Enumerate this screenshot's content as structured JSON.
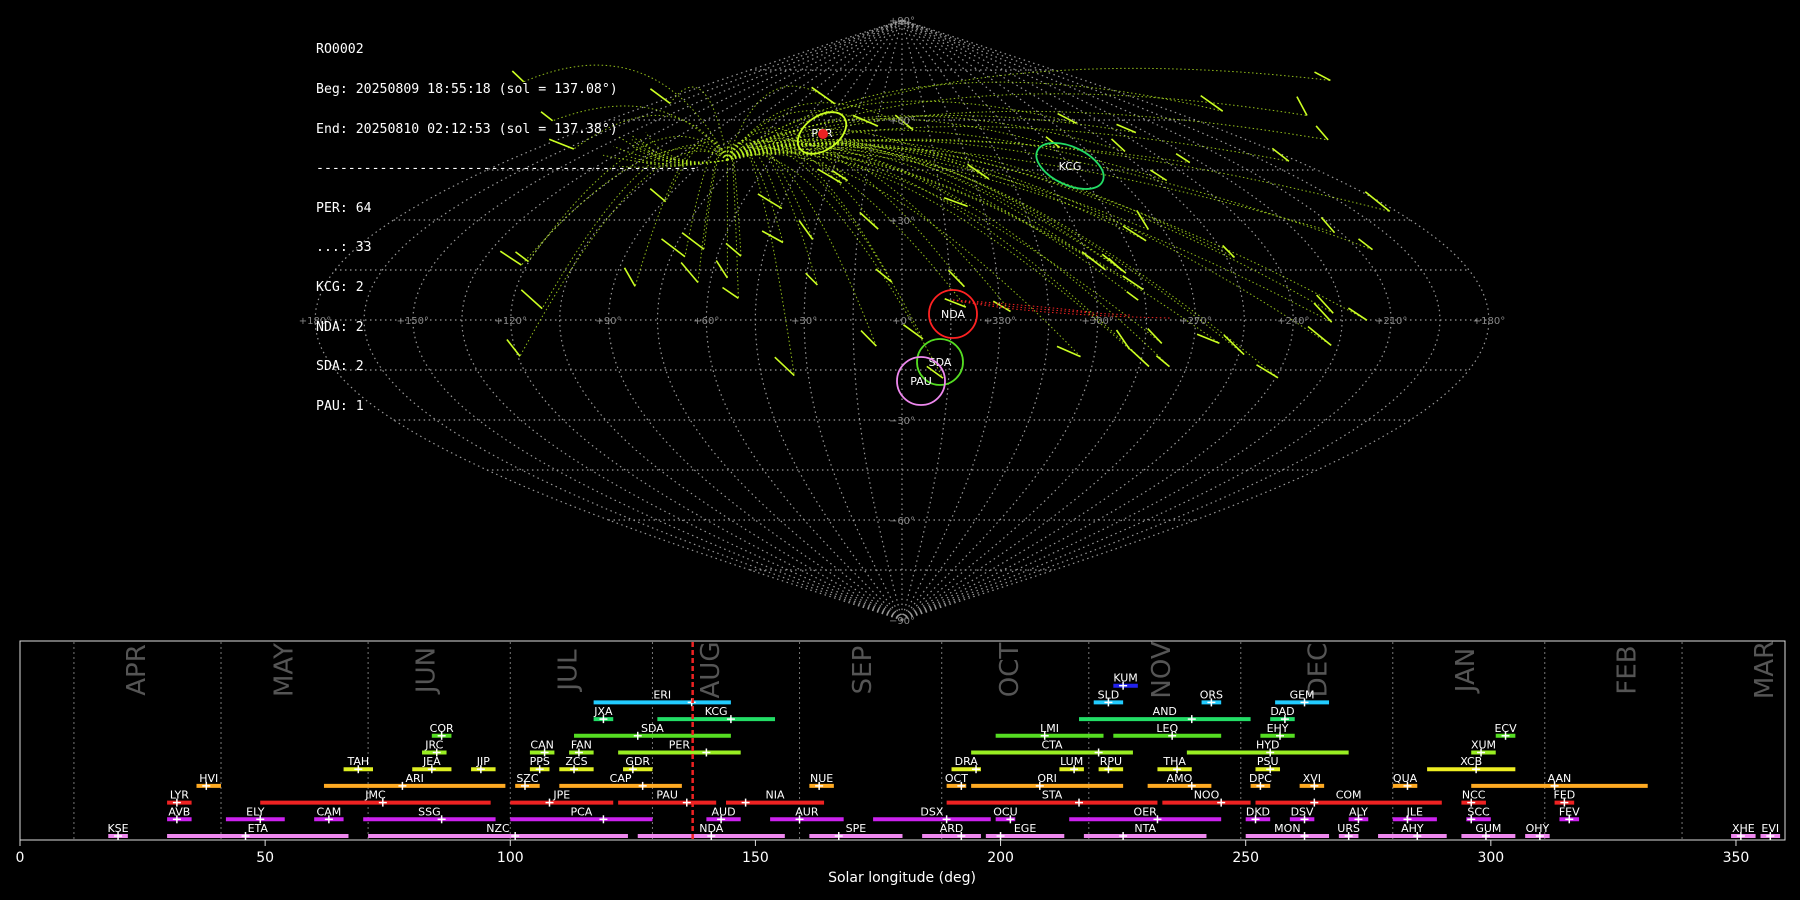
{
  "info": {
    "id": "RO0002",
    "beg": "Beg: 20250809 18:55:18 (sol = 137.08°)",
    "end": "End: 20250810 02:12:53 (sol = 137.38°)",
    "separator": "------------------------------------------------",
    "counts": [
      "PER: 64",
      "...: 33",
      "KCG: 2",
      "NDA: 2",
      "SDA: 2",
      "PAU: 1"
    ]
  },
  "sky_map": {
    "lon_labels": [
      "+180°",
      "+150°",
      "+120°",
      "+90°",
      "+60°",
      "+30°",
      "+0°",
      "+330°",
      "+300°",
      "+270°",
      "+240°",
      "+210°",
      "+180°"
    ],
    "lat_labels": [
      "+90°",
      "+60°",
      "+30°",
      "−30°",
      "−60°",
      "−90°"
    ],
    "radiants": [
      {
        "name": "PER",
        "color": "#ccff22"
      },
      {
        "name": "KCG",
        "color": "#22dd66"
      },
      {
        "name": "NDA",
        "color": "#ff2222"
      },
      {
        "name": "SDA",
        "color": "#55dd22"
      },
      {
        "name": "PAU",
        "color": "#ee88ee"
      }
    ]
  },
  "chart_data": {
    "type": "bar",
    "xlabel": "Solar longitude (deg)",
    "xlim": [
      0,
      360
    ],
    "xticks": [
      0,
      50,
      100,
      150,
      200,
      250,
      300,
      350
    ],
    "current_sol": 137.2,
    "months": [
      {
        "name": "APR",
        "start": 11,
        "mid": 24
      },
      {
        "name": "MAY",
        "start": 41,
        "mid": 54
      },
      {
        "name": "JUN",
        "start": 71,
        "mid": 83
      },
      {
        "name": "JUL",
        "start": 100,
        "mid": 112
      },
      {
        "name": "AUG",
        "start": 129,
        "mid": 141
      },
      {
        "name": "SEP",
        "start": 159,
        "mid": 172
      },
      {
        "name": "OCT",
        "start": 188,
        "mid": 202
      },
      {
        "name": "NOV",
        "start": 218,
        "mid": 233
      },
      {
        "name": "DEC",
        "start": 249,
        "mid": 265
      },
      {
        "name": "JAN",
        "start": 280,
        "mid": 295
      },
      {
        "name": "FEB",
        "start": 311,
        "mid": 328
      },
      {
        "name": "MAR",
        "start": 339,
        "mid": 356
      }
    ],
    "showers": [
      {
        "name": "KUM",
        "start": 223,
        "end": 228,
        "peak": 225,
        "row": 10,
        "color": "#2222ee"
      },
      {
        "name": "ERI",
        "start": 117,
        "end": 145,
        "peak": 137,
        "row": 9,
        "color": "#22ccff"
      },
      {
        "name": "SLD",
        "start": 219,
        "end": 225,
        "peak": 222,
        "row": 9,
        "color": "#22ccff"
      },
      {
        "name": "ORS",
        "start": 241,
        "end": 245,
        "peak": 243,
        "row": 9,
        "color": "#22ccff"
      },
      {
        "name": "GEM",
        "start": 256,
        "end": 267,
        "peak": 262,
        "row": 9,
        "color": "#22ccff"
      },
      {
        "name": "JXA",
        "start": 117,
        "end": 121,
        "peak": 119,
        "row": 8,
        "color": "#22dd66"
      },
      {
        "name": "KCG",
        "start": 130,
        "end": 154,
        "peak": 145,
        "row": 8,
        "color": "#22dd66"
      },
      {
        "name": "AND",
        "start": 216,
        "end": 251,
        "peak": 239,
        "row": 8,
        "color": "#22dd66"
      },
      {
        "name": "DAD",
        "start": 255,
        "end": 260,
        "peak": 258,
        "row": 8,
        "color": "#22dd66"
      },
      {
        "name": "COR",
        "start": 84,
        "end": 88,
        "peak": 86,
        "row": 7,
        "color": "#55dd22"
      },
      {
        "name": "SDA",
        "start": 113,
        "end": 145,
        "peak": 126,
        "row": 7,
        "color": "#55dd22"
      },
      {
        "name": "LMI",
        "start": 199,
        "end": 221,
        "peak": 209,
        "row": 7,
        "color": "#55dd22"
      },
      {
        "name": "LEQ",
        "start": 223,
        "end": 245,
        "peak": 235,
        "row": 7,
        "color": "#55dd22"
      },
      {
        "name": "EHY",
        "start": 253,
        "end": 260,
        "peak": 257,
        "row": 7,
        "color": "#55dd22"
      },
      {
        "name": "ECV",
        "start": 301,
        "end": 305,
        "peak": 303,
        "row": 7,
        "color": "#55dd22"
      },
      {
        "name": "JRC",
        "start": 82,
        "end": 87,
        "peak": 85,
        "row": 6,
        "color": "#99ee22"
      },
      {
        "name": "CAN",
        "start": 104,
        "end": 109,
        "peak": 107,
        "row": 6,
        "color": "#99ee22"
      },
      {
        "name": "FAN",
        "start": 112,
        "end": 117,
        "peak": 114,
        "row": 6,
        "color": "#99ee22"
      },
      {
        "name": "PER",
        "start": 122,
        "end": 147,
        "peak": 140,
        "row": 6,
        "color": "#99ee22"
      },
      {
        "name": "CTA",
        "start": 194,
        "end": 227,
        "peak": 220,
        "row": 6,
        "color": "#99ee22"
      },
      {
        "name": "HYD",
        "start": 238,
        "end": 271,
        "peak": 255,
        "row": 6,
        "color": "#99ee22"
      },
      {
        "name": "XUM",
        "start": 296,
        "end": 301,
        "peak": 298,
        "row": 6,
        "color": "#99ee22"
      },
      {
        "name": "TAH",
        "start": 66,
        "end": 72,
        "peak": 69,
        "row": 5,
        "color": "#ddee22"
      },
      {
        "name": "JEA",
        "start": 80,
        "end": 88,
        "peak": 84,
        "row": 5,
        "color": "#ddee22"
      },
      {
        "name": "JIP",
        "start": 92,
        "end": 97,
        "peak": 94,
        "row": 5,
        "color": "#ddee22"
      },
      {
        "name": "PPS",
        "start": 104,
        "end": 108,
        "peak": 106,
        "row": 5,
        "color": "#ddee22"
      },
      {
        "name": "ZCS",
        "start": 110,
        "end": 117,
        "peak": 113,
        "row": 5,
        "color": "#ddee22"
      },
      {
        "name": "GDR",
        "start": 123,
        "end": 129,
        "peak": 125,
        "row": 5,
        "color": "#ddee22"
      },
      {
        "name": "DRA",
        "start": 190,
        "end": 196,
        "peak": 195,
        "row": 5,
        "color": "#ddee22"
      },
      {
        "name": "LUM",
        "start": 212,
        "end": 217,
        "peak": 215,
        "row": 5,
        "color": "#ddee22"
      },
      {
        "name": "RPU",
        "start": 220,
        "end": 225,
        "peak": 222,
        "row": 5,
        "color": "#ddee22"
      },
      {
        "name": "THA",
        "start": 232,
        "end": 239,
        "peak": 236,
        "row": 5,
        "color": "#ddee22"
      },
      {
        "name": "PSU",
        "start": 252,
        "end": 257,
        "peak": 255,
        "row": 5,
        "color": "#ddee22"
      },
      {
        "name": "XCB",
        "start": 287,
        "end": 305,
        "peak": 297,
        "row": 5,
        "color": "#eeee22"
      },
      {
        "name": "HVI",
        "start": 36,
        "end": 41,
        "peak": 38,
        "row": 4,
        "color": "#ffaa22"
      },
      {
        "name": "ARI",
        "start": 62,
        "end": 99,
        "peak": 78,
        "row": 4,
        "color": "#ffaa22"
      },
      {
        "name": "SZC",
        "start": 101,
        "end": 106,
        "peak": 103,
        "row": 4,
        "color": "#ffaa22"
      },
      {
        "name": "CAP",
        "start": 110,
        "end": 135,
        "peak": 127,
        "row": 4,
        "color": "#ffaa22"
      },
      {
        "name": "NUE",
        "start": 161,
        "end": 166,
        "peak": 163,
        "row": 4,
        "color": "#ffaa22"
      },
      {
        "name": "OCT",
        "start": 189,
        "end": 193,
        "peak": 192,
        "row": 4,
        "color": "#ffaa22"
      },
      {
        "name": "ORI",
        "start": 194,
        "end": 225,
        "peak": 208,
        "row": 4,
        "color": "#ffaa22"
      },
      {
        "name": "AMO",
        "start": 230,
        "end": 243,
        "peak": 239,
        "row": 4,
        "color": "#ffaa22"
      },
      {
        "name": "DPC",
        "start": 251,
        "end": 255,
        "peak": 253,
        "row": 4,
        "color": "#ffaa22"
      },
      {
        "name": "XVI",
        "start": 261,
        "end": 266,
        "peak": 264,
        "row": 4,
        "color": "#ffaa22"
      },
      {
        "name": "QUA",
        "start": 280,
        "end": 285,
        "peak": 283,
        "row": 4,
        "color": "#ffaa22"
      },
      {
        "name": "AAN",
        "start": 296,
        "end": 332,
        "peak": 313,
        "row": 4,
        "color": "#ffaa22"
      },
      {
        "name": "LYR",
        "start": 30,
        "end": 35,
        "peak": 32,
        "row": 3,
        "color": "#ee2222"
      },
      {
        "name": "JMC",
        "start": 49,
        "end": 96,
        "peak": 74,
        "row": 3,
        "color": "#ee2222"
      },
      {
        "name": "JPE",
        "start": 100,
        "end": 121,
        "peak": 108,
        "row": 3,
        "color": "#ee2222"
      },
      {
        "name": "PAU",
        "start": 122,
        "end": 142,
        "peak": 136,
        "row": 3,
        "color": "#ee2222"
      },
      {
        "name": "NIA",
        "start": 144,
        "end": 164,
        "peak": 148,
        "row": 3,
        "color": "#ee2222"
      },
      {
        "name": "STA",
        "start": 189,
        "end": 232,
        "peak": 216,
        "row": 3,
        "color": "#ee2222"
      },
      {
        "name": "NOO",
        "start": 233,
        "end": 251,
        "peak": 245,
        "row": 3,
        "color": "#ee2222"
      },
      {
        "name": "COM",
        "start": 252,
        "end": 290,
        "peak": 264,
        "row": 3,
        "color": "#ee2222"
      },
      {
        "name": "NCC",
        "start": 294,
        "end": 299,
        "peak": 296,
        "row": 3,
        "color": "#ee2222"
      },
      {
        "name": "FED",
        "start": 313,
        "end": 317,
        "peak": 315,
        "row": 3,
        "color": "#ee2222"
      },
      {
        "name": "AVB",
        "start": 30,
        "end": 35,
        "peak": 32,
        "row": 2,
        "color": "#cc22ee"
      },
      {
        "name": "ELY",
        "start": 42,
        "end": 54,
        "peak": 49,
        "row": 2,
        "color": "#cc22ee"
      },
      {
        "name": "CAM",
        "start": 60,
        "end": 66,
        "peak": 63,
        "row": 2,
        "color": "#cc22ee"
      },
      {
        "name": "SSG",
        "start": 70,
        "end": 97,
        "peak": 86,
        "row": 2,
        "color": "#cc22ee"
      },
      {
        "name": "PCA",
        "start": 100,
        "end": 129,
        "peak": 119,
        "row": 2,
        "color": "#cc22ee"
      },
      {
        "name": "AUD",
        "start": 140,
        "end": 147,
        "peak": 143,
        "row": 2,
        "color": "#cc22ee"
      },
      {
        "name": "AUR",
        "start": 153,
        "end": 168,
        "peak": 159,
        "row": 2,
        "color": "#cc22ee"
      },
      {
        "name": "DSX",
        "start": 174,
        "end": 198,
        "peak": 189,
        "row": 2,
        "color": "#cc22ee"
      },
      {
        "name": "OCU",
        "start": 199,
        "end": 203,
        "peak": 202,
        "row": 2,
        "color": "#cc22ee"
      },
      {
        "name": "OER",
        "start": 214,
        "end": 245,
        "peak": 232,
        "row": 2,
        "color": "#cc22ee"
      },
      {
        "name": "DKD",
        "start": 250,
        "end": 255,
        "peak": 252,
        "row": 2,
        "color": "#cc22ee"
      },
      {
        "name": "DSV",
        "start": 259,
        "end": 264,
        "peak": 262,
        "row": 2,
        "color": "#cc22ee"
      },
      {
        "name": "ALY",
        "start": 271,
        "end": 275,
        "peak": 273,
        "row": 2,
        "color": "#cc22ee"
      },
      {
        "name": "JLE",
        "start": 280,
        "end": 289,
        "peak": 283,
        "row": 2,
        "color": "#cc22ee"
      },
      {
        "name": "SCC",
        "start": 295,
        "end": 300,
        "peak": 296,
        "row": 2,
        "color": "#cc22ee"
      },
      {
        "name": "FEV",
        "start": 314,
        "end": 318,
        "peak": 316,
        "row": 2,
        "color": "#cc22ee"
      },
      {
        "name": "KSE",
        "start": 18,
        "end": 22,
        "peak": 20,
        "row": 1,
        "color": "#ee88ee"
      },
      {
        "name": "ETA",
        "start": 30,
        "end": 67,
        "peak": 46,
        "row": 1,
        "color": "#ee88ee"
      },
      {
        "name": "NZC",
        "start": 71,
        "end": 124,
        "peak": 101,
        "row": 1,
        "color": "#ee88ee"
      },
      {
        "name": "NDA",
        "start": 126,
        "end": 156,
        "peak": 141,
        "row": 1,
        "color": "#ee88ee"
      },
      {
        "name": "SPE",
        "start": 161,
        "end": 180,
        "peak": 167,
        "row": 1,
        "color": "#ee88ee"
      },
      {
        "name": "ARD",
        "start": 184,
        "end": 196,
        "peak": 192,
        "row": 1,
        "color": "#ee88ee"
      },
      {
        "name": "EGE",
        "start": 197,
        "end": 213,
        "peak": 200,
        "row": 1,
        "color": "#ee88ee"
      },
      {
        "name": "NTA",
        "start": 217,
        "end": 242,
        "peak": 225,
        "row": 1,
        "color": "#ee88ee"
      },
      {
        "name": "MON",
        "start": 250,
        "end": 267,
        "peak": 262,
        "row": 1,
        "color": "#ee88ee"
      },
      {
        "name": "URS",
        "start": 269,
        "end": 273,
        "peak": 271,
        "row": 1,
        "color": "#ee88ee"
      },
      {
        "name": "AHY",
        "start": 277,
        "end": 291,
        "peak": 285,
        "row": 1,
        "color": "#ee88ee"
      },
      {
        "name": "GUM",
        "start": 294,
        "end": 305,
        "peak": 299,
        "row": 1,
        "color": "#ee88ee"
      },
      {
        "name": "OHY",
        "start": 307,
        "end": 312,
        "peak": 310,
        "row": 1,
        "color": "#ee88ee"
      },
      {
        "name": "XHE",
        "start": 349,
        "end": 354,
        "peak": 351,
        "row": 1,
        "color": "#ee88ee"
      },
      {
        "name": "EVI",
        "start": 355,
        "end": 359,
        "peak": 357,
        "row": 1,
        "color": "#ee88ee"
      }
    ]
  }
}
